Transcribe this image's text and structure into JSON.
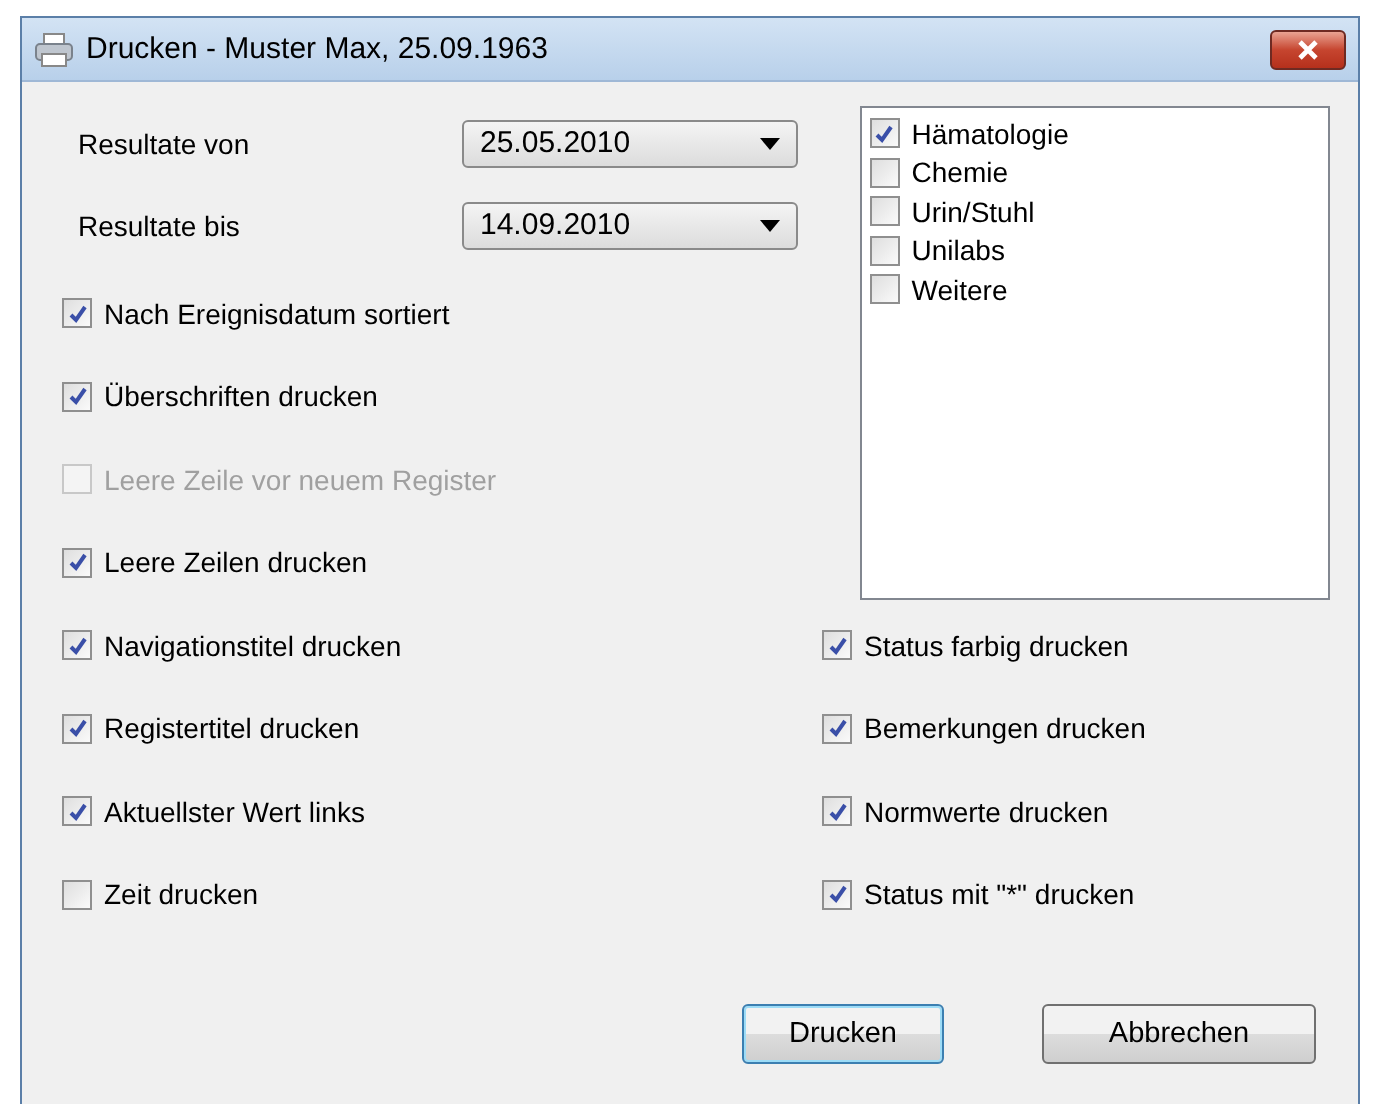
{
  "window": {
    "title": "Drucken - Muster Max, 25.09.1963"
  },
  "date_fields": [
    {
      "label": "Resultate von",
      "value": "25.05.2010"
    },
    {
      "label": "Resultate bis",
      "value": "14.09.2010"
    }
  ],
  "list_box": {
    "items": [
      {
        "label": "Hämatologie",
        "checked": true
      },
      {
        "label": "Chemie",
        "checked": false
      },
      {
        "label": "Urin/Stuhl",
        "checked": false
      },
      {
        "label": "Unilabs",
        "checked": false
      },
      {
        "label": "Weitere",
        "checked": false
      }
    ]
  },
  "left_options": [
    {
      "label": "Nach Ereignisdatum sortiert",
      "checked": true,
      "disabled": false
    },
    {
      "label": "Überschriften drucken",
      "checked": true,
      "disabled": false
    },
    {
      "label": "Leere Zeile vor neuem Register",
      "checked": false,
      "disabled": true
    },
    {
      "label": "Leere Zeilen drucken",
      "checked": true,
      "disabled": false
    },
    {
      "label": "Navigationstitel drucken",
      "checked": true,
      "disabled": false
    },
    {
      "label": "Registertitel drucken",
      "checked": true,
      "disabled": false
    },
    {
      "label": "Aktuellster Wert links",
      "checked": true,
      "disabled": false
    },
    {
      "label": "Zeit drucken",
      "checked": false,
      "disabled": false
    }
  ],
  "right_options": [
    {
      "label": "Status farbig drucken",
      "checked": true,
      "disabled": false
    },
    {
      "label": "Bemerkungen drucken",
      "checked": true,
      "disabled": false
    },
    {
      "label": "Normwerte drucken",
      "checked": true,
      "disabled": false
    },
    {
      "label": "Status mit \"*\" drucken",
      "checked": true,
      "disabled": false
    }
  ],
  "buttons": [
    {
      "label": "Drucken",
      "kind": "default"
    },
    {
      "label": "Abbrechen",
      "kind": "normal"
    }
  ]
}
